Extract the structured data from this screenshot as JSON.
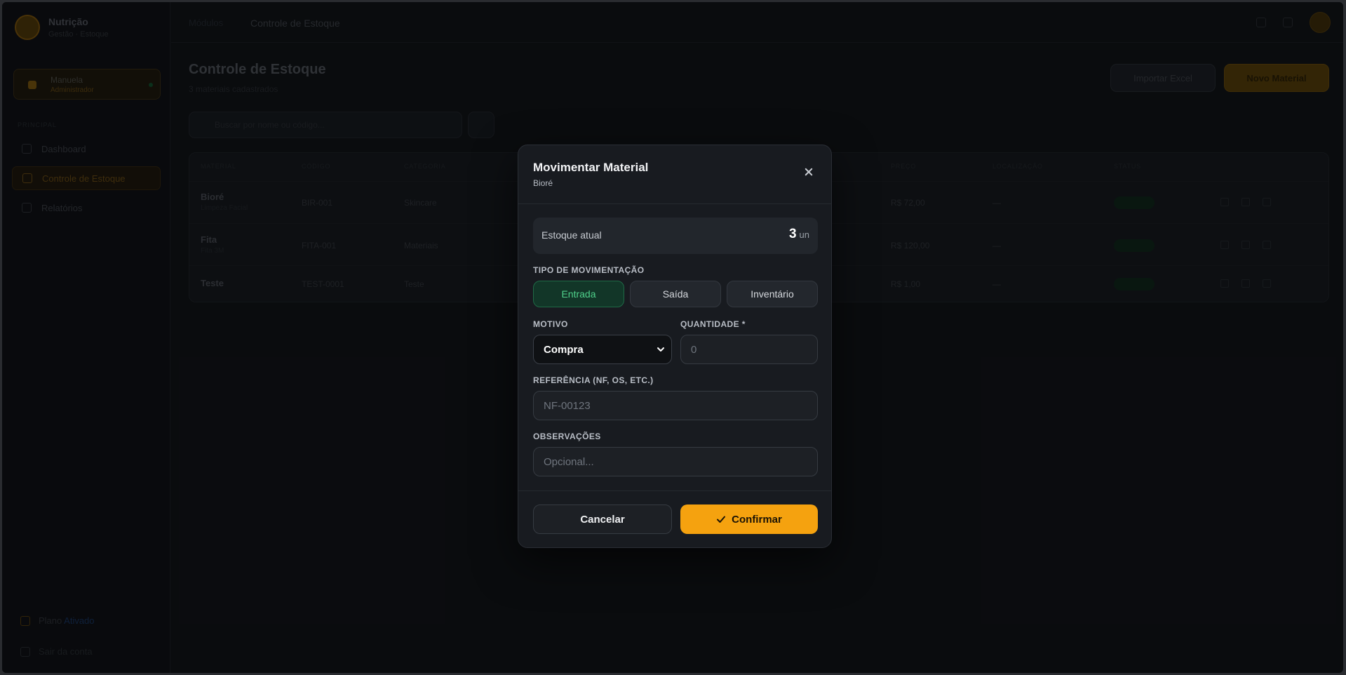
{
  "app": {
    "brand_name": "Nutrição",
    "brand_sub": "Gestão · Estoque",
    "user_name": "Manuela",
    "user_role": "Administrador",
    "nav_section": "PRINCIPAL",
    "nav": [
      {
        "label": "Dashboard"
      },
      {
        "label": "Controle de Estoque"
      },
      {
        "label": "Relatórios"
      }
    ],
    "footer_plan": "Plano",
    "footer_plan_link": "Ativado",
    "footer_logout": "Sair da conta"
  },
  "topbar": {
    "breadcrumb_root": "Módulos",
    "breadcrumb_current": "Controle de Estoque"
  },
  "page": {
    "title": "Controle de Estoque",
    "subtitle": "3 materiais cadastrados",
    "import_label": "Importar Excel",
    "new_label": "Novo Material",
    "search_placeholder": "Buscar por nome ou código..."
  },
  "table": {
    "headers": [
      "MATERIAL",
      "CÓDIGO",
      "CATEGORIA",
      "",
      "",
      "",
      "PREÇO",
      "LOCALIZAÇÃO",
      "STATUS"
    ],
    "rows": [
      {
        "name": "Bioré",
        "sub": "Limpeza Facial",
        "code": "BIR-001",
        "category": "Skincare",
        "price": "R$ 72,00",
        "location": "—",
        "status": "Normal"
      },
      {
        "name": "Fita",
        "sub": "Fita 3M",
        "code": "FITA-001",
        "category": "Materiais",
        "price": "R$ 120,00",
        "location": "—",
        "status": "Normal"
      },
      {
        "name": "Teste",
        "sub": "",
        "code": "TEST-0001",
        "category": "Teste",
        "price": "R$ 1,00",
        "location": "—",
        "status": "Normal"
      }
    ]
  },
  "modal": {
    "title": "Movimentar Material",
    "subtitle": "Bioré",
    "stock_label": "Estoque atual",
    "stock_value": "3",
    "stock_unit": "un",
    "type_label": "TIPO DE MOVIMENTAÇÃO",
    "types": [
      {
        "label": "Entrada",
        "active": true
      },
      {
        "label": "Saída",
        "active": false
      },
      {
        "label": "Inventário",
        "active": false
      }
    ],
    "reason_label": "MOTIVO",
    "reason_value": "Compra",
    "quantity_label": "QUANTIDADE *",
    "quantity_placeholder": "0",
    "reference_label": "REFERÊNCIA (NF, OS, ETC.)",
    "reference_placeholder": "NF-00123",
    "notes_label": "OBSERVAÇÕES",
    "notes_placeholder": "Opcional...",
    "cancel_label": "Cancelar",
    "confirm_label": "Confirmar"
  },
  "colors": {
    "accent": "#f5a20f",
    "success": "#4fd18b",
    "modal_bg": "#181b20"
  }
}
